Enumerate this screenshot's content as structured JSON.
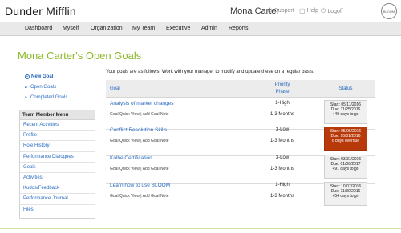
{
  "header": {
    "brand": "Dunder Mifflin",
    "user_name": "Mona Carter",
    "support": "Support",
    "help": "Help",
    "logoff": "Logoff",
    "logo_text": "BLOOM"
  },
  "nav": [
    "Dashboard",
    "Myself",
    "Organization",
    "My Team",
    "Executive",
    "Admin",
    "Reports"
  ],
  "page": {
    "title": "Mona Carter's Open Goals",
    "intro": "Your goals are as follows. Work with your manager to modify and update these on a regular basis."
  },
  "left_links": {
    "new_goal": "New Goal",
    "open_goals": "Open Goals",
    "completed_goals": "Completed Goals"
  },
  "side_menu": {
    "heading": "Team Member Menu",
    "items": [
      "Recent Activities",
      "Profile",
      "Role History",
      "Performance Dialogues",
      "Goals",
      "Activities",
      "Kudos/Feedback",
      "Performance Journal",
      "Files"
    ]
  },
  "table": {
    "headers": {
      "goal": "Goal",
      "priority": "Priority",
      "phase": "Phase",
      "status": "Status"
    },
    "rows": [
      {
        "title": "Analysis of market changes",
        "quick_view": "Goal Quick View",
        "sep": "|",
        "add_note": "Add Goal Note",
        "priority": "1-High",
        "phase": "1-3 Months",
        "start": "Start: 05/11/2016",
        "due": "Due: 11/25/2016",
        "note": "+49 days to go",
        "overdue": false
      },
      {
        "title": "Conflict Resolution Skills",
        "quick_view": "Goal Quick View",
        "sep": "|",
        "add_note": "Add Goal Note",
        "priority": "3-Low",
        "phase": "1-3 Months",
        "start": "Start: 05/06/2016",
        "due": "Due: 10/01/2016",
        "note": "6 days overdue",
        "overdue": true
      },
      {
        "title": "Kolbe Certification",
        "quick_view": "Goal Quick View",
        "sep": "|",
        "add_note": "Add Goal Note",
        "priority": "3-Low",
        "phase": "1-3 Months",
        "start": "Start: 03/31/2016",
        "due": "Due: 01/06/2017",
        "note": "+91 days to go",
        "overdue": false
      },
      {
        "title": "Learn how to use BLOOM",
        "quick_view": "Goal Quick View",
        "sep": "|",
        "add_note": "Add Goal Note",
        "priority": "1-High",
        "phase": "1-3 Months",
        "start": "Start: 10/07/2016",
        "due": "Due: 11/30/2016",
        "note": "+54 days to go",
        "overdue": false
      }
    ]
  },
  "colors": {
    "accent_green": "#8cb82a",
    "link_blue": "#2a6cc0",
    "overdue": "#b83a0a"
  }
}
